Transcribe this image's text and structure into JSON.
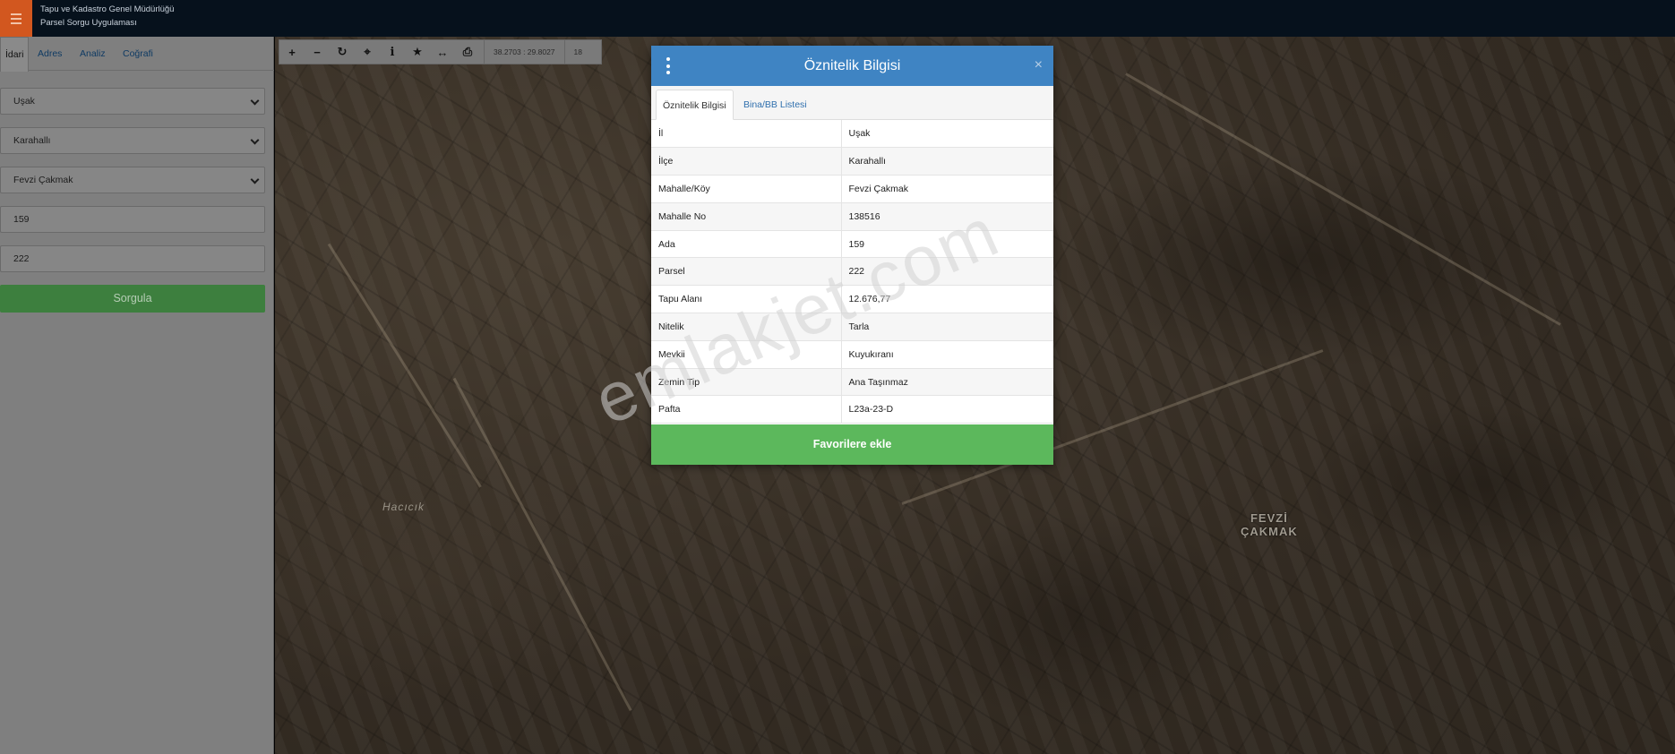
{
  "app": {
    "title_line1": "Tapu ve Kadastro Genel Müdürlüğü",
    "title_line2": "Parsel Sorgu Uygulaması"
  },
  "sidebar": {
    "tabs": [
      {
        "label": "İdari",
        "active": true
      },
      {
        "label": "Adres",
        "active": false
      },
      {
        "label": "Analiz",
        "active": false
      },
      {
        "label": "Coğrafi",
        "active": false
      }
    ],
    "il": "Uşak",
    "ilce": "Karahallı",
    "mahalle": "Fevzi Çakmak",
    "ada": "159",
    "parsel": "222",
    "query_button": "Sorgula"
  },
  "toolbar": {
    "coords": "38.2703 : 29.8027",
    "zoom": "18",
    "icons": [
      "zoom-in-icon",
      "zoom-out-icon",
      "refresh-icon",
      "locate-icon",
      "info-icon",
      "favorite-icon",
      "measure-icon",
      "print-icon"
    ]
  },
  "map": {
    "labels": {
      "village_left": "Hacıcık",
      "village_right_line1": "FEVZİ",
      "village_right_line2": "ÇAKMAK"
    },
    "watermark": "emlakjet.com"
  },
  "dialog": {
    "title": "Öznitelik Bilgisi",
    "close": "×",
    "tabs": [
      {
        "label": "Öznitelik Bilgisi",
        "active": true
      },
      {
        "label": "Bina/BB Listesi",
        "active": false
      }
    ],
    "rows": [
      {
        "key": "İl",
        "value": "Uşak"
      },
      {
        "key": "İlçe",
        "value": "Karahallı"
      },
      {
        "key": "Mahalle/Köy",
        "value": "Fevzi Çakmak"
      },
      {
        "key": "Mahalle No",
        "value": "138516"
      },
      {
        "key": "Ada",
        "value": "159"
      },
      {
        "key": "Parsel",
        "value": "222"
      },
      {
        "key": "Tapu Alanı",
        "value": "12.676,77"
      },
      {
        "key": "Nitelik",
        "value": "Tarla"
      },
      {
        "key": "Mevkii",
        "value": "Kuyukıranı"
      },
      {
        "key": "Zemin Tip",
        "value": "Ana Taşınmaz"
      },
      {
        "key": "Pafta",
        "value": "L23a-23-D"
      }
    ],
    "favorite_button": "Favorilere ekle"
  },
  "colors": {
    "header_bg": "#06111c",
    "menu_accent": "#d2571f",
    "dialog_header": "#3f84c3",
    "favorite_green": "#5cb85c",
    "query_green": "#3d7f3e"
  }
}
